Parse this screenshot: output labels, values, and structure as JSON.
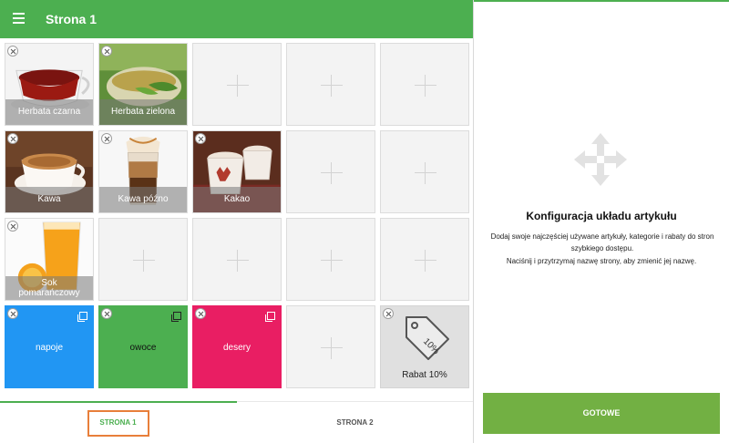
{
  "app": {
    "title": "Strona 1"
  },
  "tiles": {
    "herbata_czarna": "Herbata czarna",
    "herbata_zielona": "Herbata zielona",
    "kawa": "Kawa",
    "kawa_pozno": "Kawa późno",
    "kakao": "Kakao",
    "sok_line1": "Sok",
    "sok_line2": "pomarańczowy",
    "napoje": "napoje",
    "owoce": "owoce",
    "desery": "desery",
    "rabat": "Rabat 10%",
    "rabat_tag": "10%"
  },
  "colors": {
    "accent": "#4caf50",
    "napoje": "#2196f3",
    "owoce": "#4caf50",
    "desery": "#e91e63",
    "done_button": "#72b043",
    "highlight": "#e87f3a"
  },
  "tabs": {
    "page1": "STRONA 1",
    "page2": "STRONA 2"
  },
  "panel": {
    "title": "Konfiguracja układu artykułu",
    "description": "Dodaj swoje najczęściej używane artykuły, kategorie i rabaty do stron szybkiego dostępu.",
    "hint": "Naciśnij i przytrzymaj nazwę strony, aby zmienić jej nazwę.",
    "done_label": "GOTOWE"
  }
}
